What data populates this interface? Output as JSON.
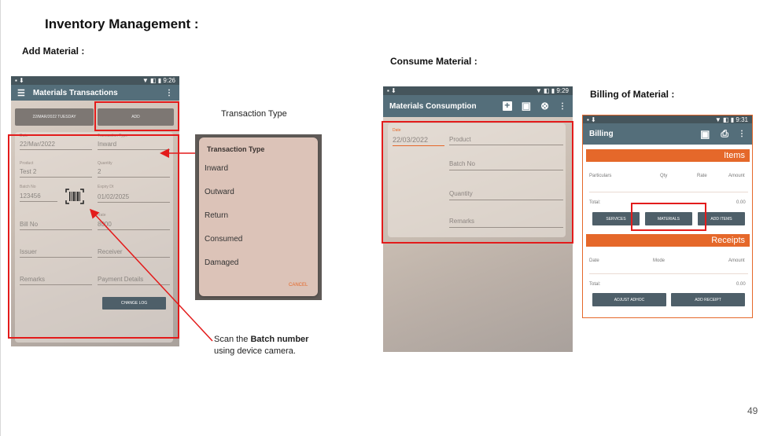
{
  "slide": {
    "title": "Inventory Management :",
    "page_number": "49",
    "sections": {
      "add_material": "Add Material :",
      "consume_material": "Consume Material :",
      "billing_material": "Billing of Material :"
    },
    "annotations": {
      "transaction_type": "Transaction Type",
      "scan_prefix": "Scan the ",
      "scan_bold": "Batch number",
      "scan_suffix": "using device camera."
    }
  },
  "add_phone": {
    "status_time": "9:26",
    "app_title": "Materials Transactions",
    "date_button": "22/MAR/2022 TUESDAY",
    "add_button": "ADD",
    "fields": {
      "date_label": "Date",
      "date_value": "22/Mar/2022",
      "ttype_label": "Transaction Type",
      "ttype_value": "Inward",
      "product_label": "Product",
      "product_value": "Test 2",
      "qty_label": "Quantity",
      "qty_value": "2",
      "batch_label": "Batch No",
      "batch_value": "123456",
      "expiry_label": "Expiry Dt",
      "expiry_value": "01/02/2025",
      "billno": "Bill No",
      "rate_label": "Rate",
      "rate_value": "8000",
      "issuer": "Issuer",
      "receiver": "Receiver",
      "remarks": "Remarks",
      "payment": "Payment Details"
    },
    "change_log": "CHANGE LOG"
  },
  "dialog": {
    "title": "Transaction Type",
    "options": [
      "Inward",
      "Outward",
      "Return",
      "Consumed",
      "Damaged"
    ],
    "cancel": "CANCEL"
  },
  "consume_phone": {
    "status_time": "9:29",
    "app_title": "Materials Consumption",
    "date_label": "Date",
    "date_value": "22/03/2022",
    "product": "Product",
    "batch": "Batch No",
    "quantity": "Quantity",
    "remarks": "Remarks"
  },
  "billing_phone": {
    "status_time": "9:31",
    "app_title": "Billing",
    "items_header": "Items",
    "items_cols": [
      "Particulars",
      "Qty",
      "Rate",
      "Amount"
    ],
    "total_label": "Total:",
    "items_total": "0.00",
    "services": "SERVICES",
    "materials": "MATERIALS",
    "add_items": "ADD ITEMS",
    "receipts_header": "Receipts",
    "receipts_cols": [
      "Date",
      "Mode",
      "Amount"
    ],
    "receipts_total": "0.00",
    "adjust": "ADJUST ADHOC",
    "add_receipt": "ADD RECEIPT"
  },
  "colors": {
    "accent_red": "#e31b1b",
    "appbar": "#546e7a",
    "billing_orange": "#e5682a"
  }
}
